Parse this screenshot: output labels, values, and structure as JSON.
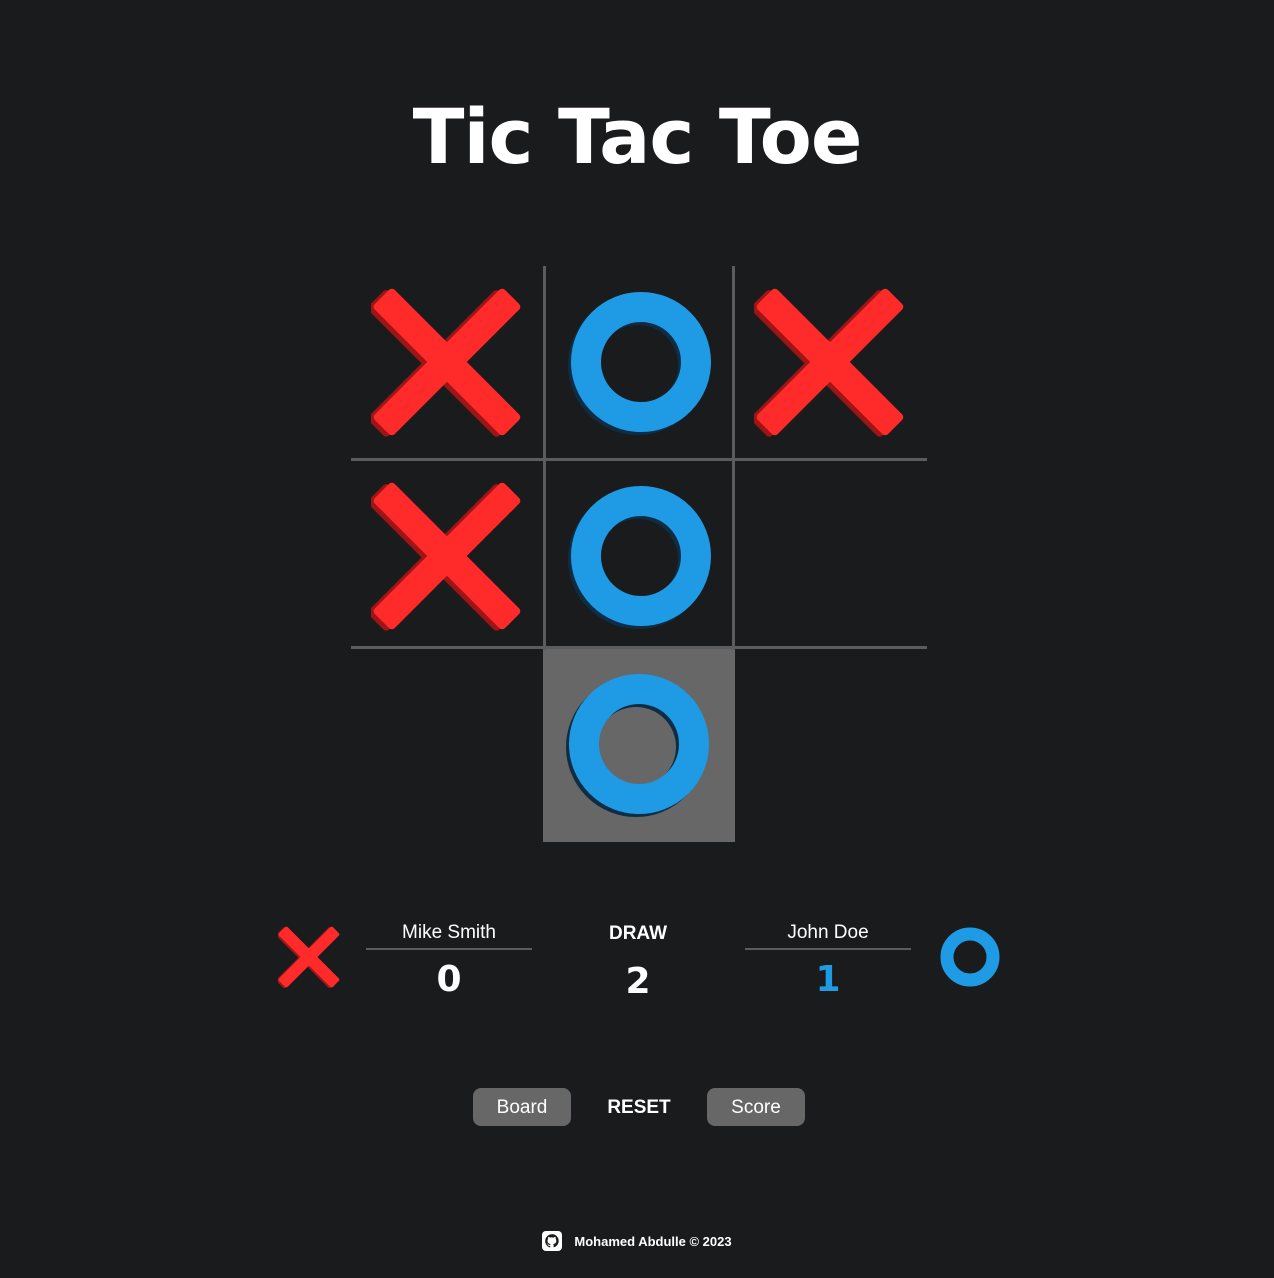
{
  "title": "Tic Tac Toe",
  "colors": {
    "background": "#1a1b1d",
    "x_mark": "#ff2a2a",
    "o_mark": "#1e9be4",
    "grid_line": "#5c5c5c",
    "highlight": "#676767"
  },
  "board": {
    "cells": [
      "X",
      "O",
      "X",
      "X",
      "O",
      "",
      "",
      "O",
      ""
    ],
    "winning_cells": [
      7
    ]
  },
  "scoreboard": {
    "player_x": {
      "symbol": "X",
      "name": "Mike Smith",
      "score": "0",
      "icon": "x-icon"
    },
    "draw": {
      "label": "DRAW",
      "count": "2"
    },
    "player_o": {
      "symbol": "O",
      "name": "John Doe",
      "score": "1",
      "icon": "o-icon"
    }
  },
  "controls": {
    "board_label": "Board",
    "reset_label": "RESET",
    "score_label": "Score"
  },
  "footer": {
    "text": "Mohamed Abdulle © 2023",
    "icon": "github-icon"
  }
}
